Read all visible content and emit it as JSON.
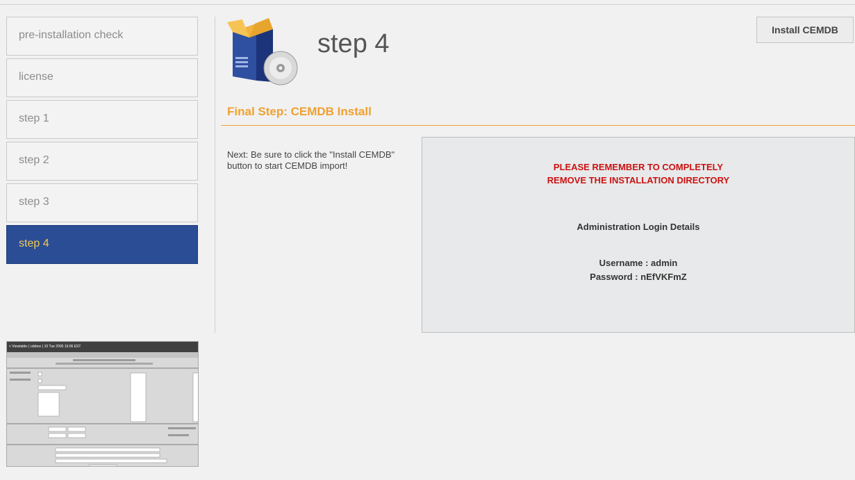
{
  "nav": {
    "items": [
      {
        "label": "pre-installation check"
      },
      {
        "label": "license"
      },
      {
        "label": "step 1"
      },
      {
        "label": "step 2"
      },
      {
        "label": "step 3"
      },
      {
        "label": "step 4",
        "active": true
      }
    ]
  },
  "header": {
    "title": "step 4",
    "install_button": "Install CEMDB",
    "logo_icon": "install-box-cd-icon"
  },
  "main": {
    "section_heading": "Final Step: CEMDB Install",
    "note": "Next: Be sure to click the \"Install CEMDB\" button to start CEMDB import!",
    "warning_line1": "PLEASE REMEMBER TO COMPLETELY",
    "warning_line2": "REMOVE THE INSTALLATION DIRECTORY",
    "admin_title": "Administration Login Details",
    "username_line": "Username : admin",
    "password_line": "Password : nEfVKFmZ"
  },
  "thumbnail": {
    "titlebar": "< Viewtable ( cdsbox ) 10 Tue 2005 16:06 EST"
  },
  "colors": {
    "accent_orange": "#f0a030",
    "active_nav": "#2a4d96",
    "warning_red": "#cc1111"
  }
}
